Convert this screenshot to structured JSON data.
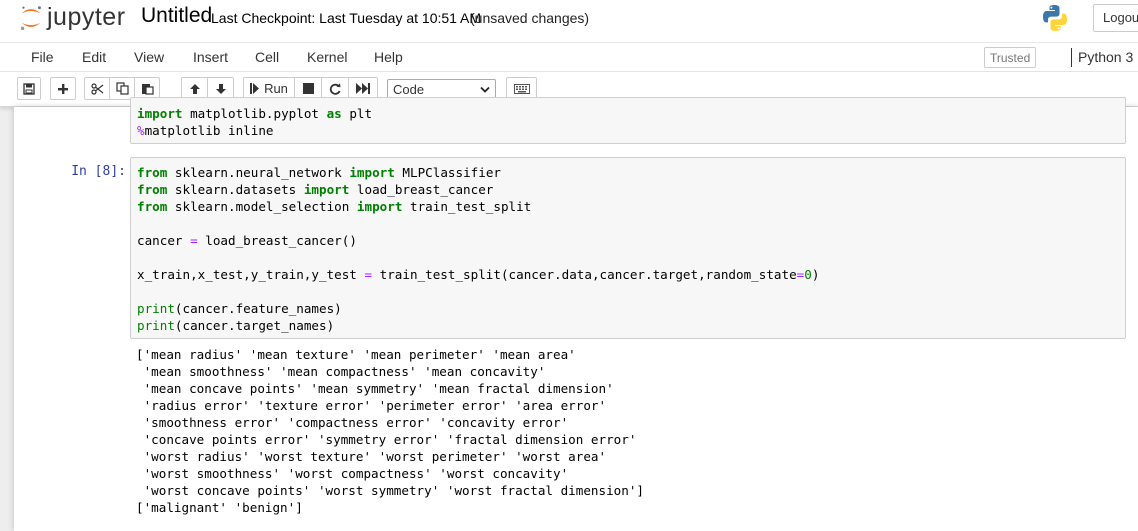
{
  "header": {
    "logo_text": "jupyter",
    "notebook_name": "Untitled",
    "checkpoint": "Last Checkpoint: Last Tuesday at 10:51 AM",
    "autosave_status": "(unsaved changes)",
    "logout_label": "Logout"
  },
  "menubar": {
    "items": [
      "File",
      "Edit",
      "View",
      "Insert",
      "Cell",
      "Kernel",
      "Help"
    ],
    "trusted_label": "Trusted",
    "kernel_name": "Python 3"
  },
  "toolbar": {
    "run_label": "Run",
    "cell_type": "Code"
  },
  "cells": {
    "cell1": {
      "lines": [
        [
          [
            "kw",
            "import"
          ],
          [
            "t",
            " matplotlib.pyplot "
          ],
          [
            "kw",
            "as"
          ],
          [
            "t",
            " plt"
          ]
        ],
        [
          [
            "magic",
            "%"
          ],
          [
            "t",
            "matplotlib inline"
          ]
        ]
      ]
    },
    "cell2": {
      "prompt": "In [8]:",
      "lines": [
        [
          [
            "kw",
            "from"
          ],
          [
            "t",
            " sklearn.neural_network "
          ],
          [
            "kw",
            "import"
          ],
          [
            "t",
            " MLPClassifier"
          ]
        ],
        [
          [
            "kw",
            "from"
          ],
          [
            "t",
            " sklearn.datasets "
          ],
          [
            "kw",
            "import"
          ],
          [
            "t",
            " load_breast_cancer"
          ]
        ],
        [
          [
            "kw",
            "from"
          ],
          [
            "t",
            " sklearn.model_selection "
          ],
          [
            "kw",
            "import"
          ],
          [
            "t",
            " train_test_split"
          ]
        ],
        [],
        [
          [
            "t",
            "cancer "
          ],
          [
            "op",
            "="
          ],
          [
            "t",
            " load_breast_cancer()"
          ]
        ],
        [],
        [
          [
            "t",
            "x_train,x_test,y_train,y_test "
          ],
          [
            "op",
            "="
          ],
          [
            "t",
            " train_test_split(cancer.data,cancer.target,random_state"
          ],
          [
            "op",
            "="
          ],
          [
            "num",
            "0"
          ],
          [
            "t",
            ")"
          ]
        ],
        [],
        [
          [
            "bi",
            "print"
          ],
          [
            "t",
            "(cancer.feature_names)"
          ]
        ],
        [
          [
            "bi",
            "print"
          ],
          [
            "t",
            "(cancer.target_names)"
          ]
        ]
      ],
      "output": [
        "['mean radius' 'mean texture' 'mean perimeter' 'mean area'",
        " 'mean smoothness' 'mean compactness' 'mean concavity'",
        " 'mean concave points' 'mean symmetry' 'mean fractal dimension'",
        " 'radius error' 'texture error' 'perimeter error' 'area error'",
        " 'smoothness error' 'compactness error' 'concavity error'",
        " 'concave points error' 'symmetry error' 'fractal dimension error'",
        " 'worst radius' 'worst texture' 'worst perimeter' 'worst area'",
        " 'worst smoothness' 'worst compactness' 'worst concavity'",
        " 'worst concave points' 'worst symmetry' 'worst fractal dimension']",
        "['malignant' 'benign']"
      ]
    }
  },
  "colors": {
    "keyword": "#008000",
    "operator": "#aa22ff",
    "prompt": "#303f9f",
    "logo_orange": "#f37726"
  },
  "icons": {
    "save": "save-icon",
    "insert": "plus-icon",
    "cut": "scissors-icon",
    "copy": "copy-icon",
    "paste": "paste-icon",
    "up": "arrow-up-icon",
    "down": "arrow-down-icon",
    "run": "step-forward-icon",
    "stop": "stop-icon",
    "restart": "refresh-icon",
    "restart_run": "fast-forward-icon",
    "palette": "keyboard-icon"
  }
}
